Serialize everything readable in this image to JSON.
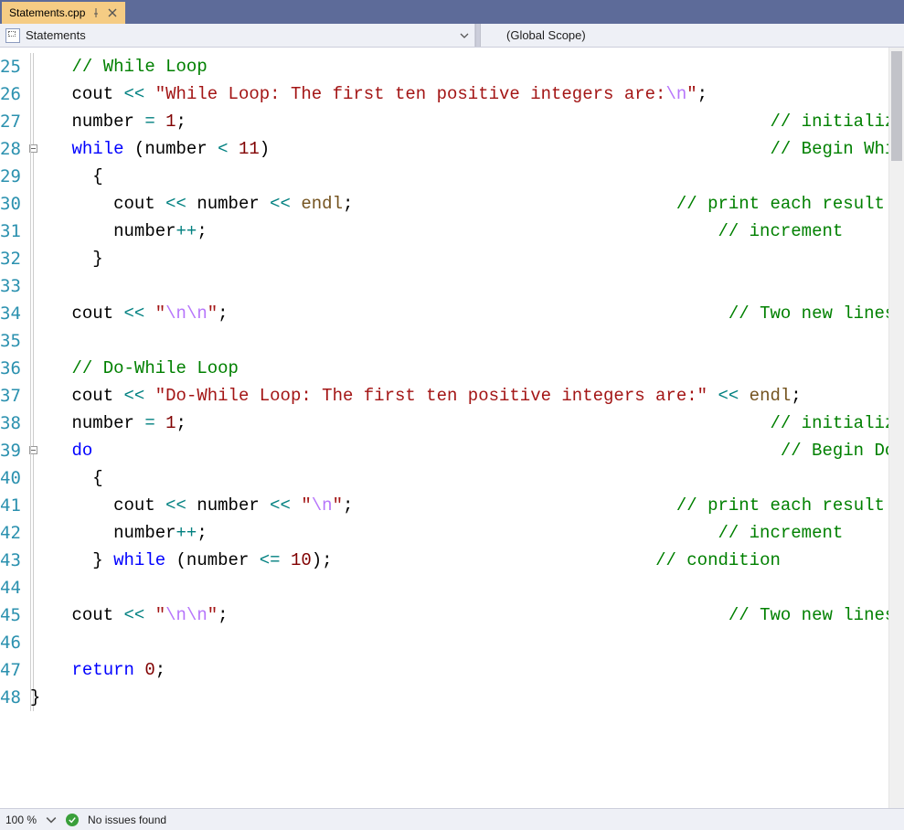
{
  "tab": {
    "filename": "Statements.cpp"
  },
  "breadcrumbs": {
    "left": "Statements",
    "right": "(Global Scope)"
  },
  "status": {
    "zoom": "100 %",
    "issues": "No issues found"
  },
  "lines": {
    "start": 25,
    "count": 24,
    "fold_boxes": [
      28,
      39
    ]
  },
  "code": {
    "25": [
      [
        "comment",
        "// While Loop"
      ]
    ],
    "26": [
      [
        "ident",
        "cout "
      ],
      [
        "stream",
        "<<"
      ],
      [
        "ident",
        " "
      ],
      [
        "string",
        "\"While Loop: The first ten positive integers are:"
      ],
      [
        "escape",
        "\\n"
      ],
      [
        "string",
        "\""
      ],
      [
        "ident",
        ";"
      ]
    ],
    "27": [
      [
        "ident",
        "number "
      ],
      [
        "stream",
        "="
      ],
      [
        "ident",
        " "
      ],
      [
        "maroon",
        "1"
      ],
      [
        "ident",
        ";"
      ],
      [
        "pad",
        "                                                        "
      ],
      [
        "comment",
        "// initialize"
      ]
    ],
    "28": [
      [
        "keyword",
        "while"
      ],
      [
        "ident",
        " (number "
      ],
      [
        "stream",
        "<"
      ],
      [
        "ident",
        " "
      ],
      [
        "maroon",
        "11"
      ],
      [
        "ident",
        ")"
      ],
      [
        "pad",
        "                                                "
      ],
      [
        "comment",
        "// Begin While Loop, condition"
      ]
    ],
    "29": [
      [
        "ident",
        "  {"
      ]
    ],
    "30": [
      [
        "ident",
        "    cout "
      ],
      [
        "stream",
        "<<"
      ],
      [
        "ident",
        " number "
      ],
      [
        "stream",
        "<<"
      ],
      [
        "ident",
        " "
      ],
      [
        "purple",
        "endl"
      ],
      [
        "ident",
        ";"
      ],
      [
        "pad",
        "                               "
      ],
      [
        "comment",
        "// print each result on a new line"
      ]
    ],
    "31": [
      [
        "ident",
        "    number"
      ],
      [
        "stream",
        "++"
      ],
      [
        "ident",
        ";"
      ],
      [
        "pad",
        "                                                 "
      ],
      [
        "comment",
        "// increment"
      ]
    ],
    "32": [
      [
        "ident",
        "  }"
      ]
    ],
    "33": [],
    "34": [
      [
        "ident",
        "cout "
      ],
      [
        "stream",
        "<<"
      ],
      [
        "ident",
        " "
      ],
      [
        "string",
        "\""
      ],
      [
        "escape",
        "\\n\\n"
      ],
      [
        "string",
        "\""
      ],
      [
        "ident",
        ";"
      ],
      [
        "pad",
        "                                                "
      ],
      [
        "comment",
        "// Two new lines separation"
      ]
    ],
    "35": [],
    "36": [
      [
        "comment",
        "// Do-While Loop"
      ]
    ],
    "37": [
      [
        "ident",
        "cout "
      ],
      [
        "stream",
        "<<"
      ],
      [
        "ident",
        " "
      ],
      [
        "string",
        "\"Do-While Loop: The first ten positive integers are:\""
      ],
      [
        "ident",
        " "
      ],
      [
        "stream",
        "<<"
      ],
      [
        "ident",
        " "
      ],
      [
        "purple",
        "endl"
      ],
      [
        "ident",
        ";"
      ]
    ],
    "38": [
      [
        "ident",
        "number "
      ],
      [
        "stream",
        "="
      ],
      [
        "ident",
        " "
      ],
      [
        "maroon",
        "1"
      ],
      [
        "ident",
        ";"
      ],
      [
        "pad",
        "                                                        "
      ],
      [
        "comment",
        "// initialize"
      ]
    ],
    "39": [
      [
        "keyword",
        "do"
      ],
      [
        "pad",
        "                                                                  "
      ],
      [
        "comment",
        "// Begin Do-While Loop"
      ]
    ],
    "40": [
      [
        "ident",
        "  {"
      ]
    ],
    "41": [
      [
        "ident",
        "    cout "
      ],
      [
        "stream",
        "<<"
      ],
      [
        "ident",
        " number "
      ],
      [
        "stream",
        "<<"
      ],
      [
        "ident",
        " "
      ],
      [
        "string",
        "\""
      ],
      [
        "escape",
        "\\n"
      ],
      [
        "string",
        "\""
      ],
      [
        "ident",
        ";"
      ],
      [
        "pad",
        "                               "
      ],
      [
        "comment",
        "// print each result on a new line"
      ]
    ],
    "42": [
      [
        "ident",
        "    number"
      ],
      [
        "stream",
        "++"
      ],
      [
        "ident",
        ";"
      ],
      [
        "pad",
        "                                                 "
      ],
      [
        "comment",
        "// increment"
      ]
    ],
    "43": [
      [
        "ident",
        "  } "
      ],
      [
        "keyword",
        "while"
      ],
      [
        "ident",
        " (number "
      ],
      [
        "stream",
        "<="
      ],
      [
        "ident",
        " "
      ],
      [
        "maroon",
        "10"
      ],
      [
        "ident",
        ");"
      ],
      [
        "pad",
        "                               "
      ],
      [
        "comment",
        "// condition"
      ]
    ],
    "44": [],
    "45": [
      [
        "ident",
        "cout "
      ],
      [
        "stream",
        "<<"
      ],
      [
        "ident",
        " "
      ],
      [
        "string",
        "\""
      ],
      [
        "escape",
        "\\n\\n"
      ],
      [
        "string",
        "\""
      ],
      [
        "ident",
        ";"
      ],
      [
        "pad",
        "                                                "
      ],
      [
        "comment",
        "// Two new lines separation"
      ]
    ],
    "46": [],
    "47": [
      [
        "keyword",
        "return"
      ],
      [
        "ident",
        " "
      ],
      [
        "maroon",
        "0"
      ],
      [
        "ident",
        ";"
      ]
    ],
    "48": [
      [
        "ident_end",
        "}"
      ]
    ]
  }
}
